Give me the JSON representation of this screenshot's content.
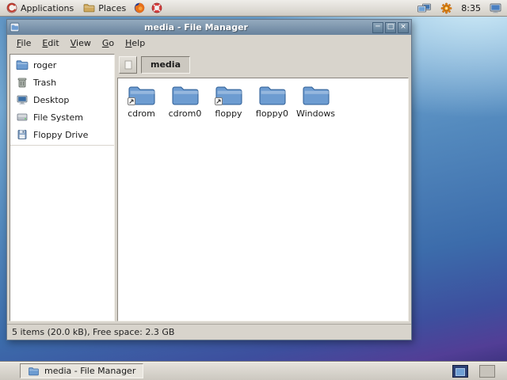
{
  "top_panel": {
    "applications_label": "Applications",
    "places_label": "Places",
    "clock": "8:35"
  },
  "window": {
    "title": "media - File Manager",
    "controls": {
      "minimize": "─",
      "maximize": "□",
      "close": "×"
    },
    "menus": [
      "File",
      "Edit",
      "View",
      "Go",
      "Help"
    ],
    "pathbar": {
      "current": "media"
    },
    "sidebar": [
      {
        "label": "roger"
      },
      {
        "label": "Trash"
      },
      {
        "label": "Desktop"
      },
      {
        "label": "File System"
      },
      {
        "label": "Floppy Drive"
      }
    ],
    "files": [
      {
        "label": "cdrom",
        "shortcut": true
      },
      {
        "label": "cdrom0",
        "shortcut": false
      },
      {
        "label": "floppy",
        "shortcut": true
      },
      {
        "label": "floppy0",
        "shortcut": false
      },
      {
        "label": "Windows",
        "shortcut": false
      }
    ],
    "status": "5 items (20.0 kB), Free space: 2.3 GB"
  },
  "taskbar": {
    "task_label": "media - File Manager",
    "workspaces": 2
  },
  "colors": {
    "titlebar_top": "#94aabe",
    "titlebar_bottom": "#68839d",
    "window_bg": "#d8d4cc",
    "folder_blue": "#6d9cd1",
    "desktop_light": "#74a9d4",
    "desktop_dark": "#2f2c70"
  }
}
